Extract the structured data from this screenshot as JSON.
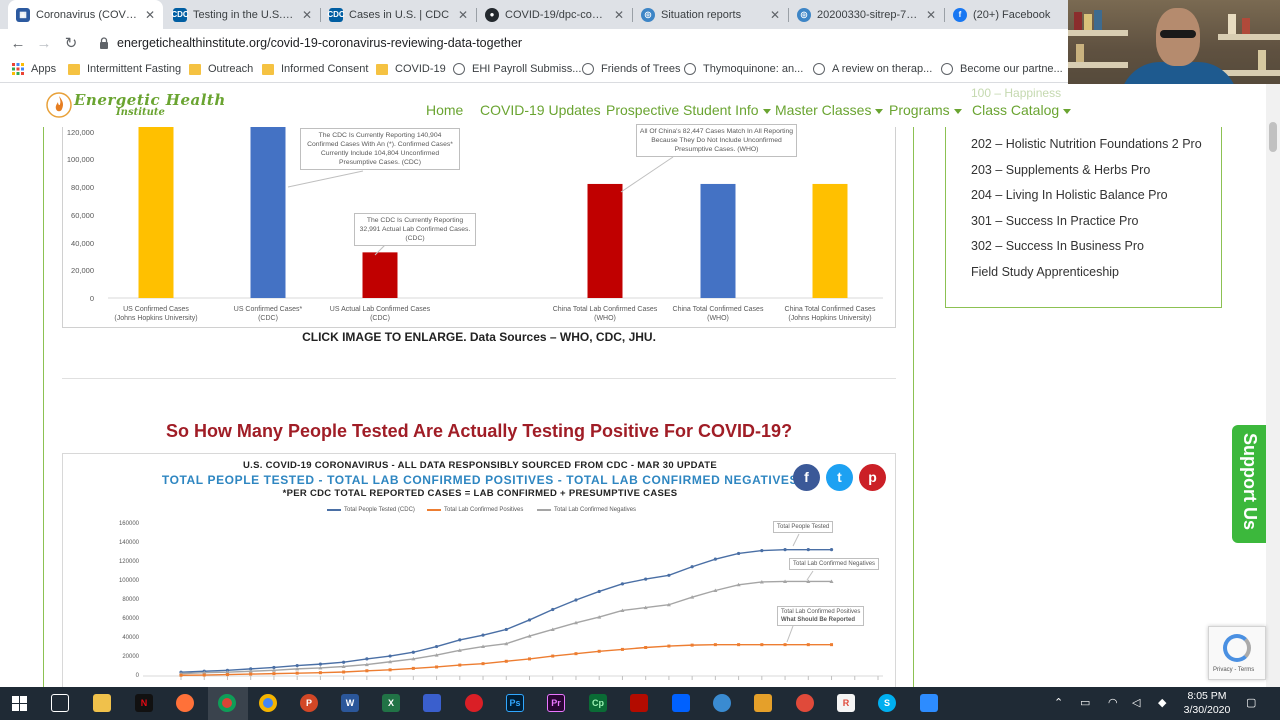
{
  "browser": {
    "tabs": [
      {
        "title": "Coronavirus (COVID-19",
        "icon": "grid-icon",
        "color": "#2c5aa0",
        "active": true
      },
      {
        "title": "Testing in the U.S. | CD",
        "icon": "cdc-icon",
        "color": "#005ea2"
      },
      {
        "title": "Cases in U.S. | CDC",
        "icon": "cdc-icon",
        "color": "#005ea2"
      },
      {
        "title": "COVID-19/dpc-covid19",
        "icon": "github-icon",
        "color": "#24292e"
      },
      {
        "title": "Situation reports",
        "icon": "who-icon",
        "color": "#3d85c6"
      },
      {
        "title": "20200330-sitrep-70-co",
        "icon": "who-icon",
        "color": "#3d85c6"
      },
      {
        "title": "(20+) Facebook",
        "icon": "facebook-icon",
        "color": "#1877f2"
      }
    ],
    "url": "energetichealthinstitute.org/covid-19-coronavirus-reviewing-data-together",
    "bookmarks": [
      {
        "label": "Apps",
        "icon": "apps-icon"
      },
      {
        "label": "Intermittent Fasting",
        "icon": "folder-icon"
      },
      {
        "label": "Outreach",
        "icon": "folder-icon"
      },
      {
        "label": "Informed Consent",
        "icon": "folder-icon"
      },
      {
        "label": "COVID-19",
        "icon": "folder-icon"
      },
      {
        "label": "EHI Payroll Submiss...",
        "icon": "globe-icon"
      },
      {
        "label": "Friends of Trees",
        "icon": "globe-icon"
      },
      {
        "label": "Thymoquinone: an...",
        "icon": "globe-icon"
      },
      {
        "label": "A review on therap...",
        "icon": "globe-icon"
      },
      {
        "label": "Become our partne...",
        "icon": "globe-icon"
      }
    ]
  },
  "site": {
    "logo_line1": "Energetic Health",
    "logo_line2": "Institute",
    "menu": [
      {
        "label": "Home",
        "dropdown": false
      },
      {
        "label": "COVID-19 Updates",
        "dropdown": false
      },
      {
        "label": "Prospective Student Info",
        "dropdown": true
      },
      {
        "label": "Master Classes",
        "dropdown": true
      },
      {
        "label": "Programs",
        "dropdown": true
      },
      {
        "label": "Class Catalog",
        "dropdown": true
      }
    ],
    "accent": "#6aa431"
  },
  "chart1": {
    "ytick_labels": [
      "120,000",
      "100,000",
      "80,000",
      "60,000",
      "40,000",
      "20,000",
      "0"
    ],
    "categories": [
      "US Confirmed Cases\n(Johns Hopkins University)",
      "US Confirmed Cases*\n(CDC)",
      "US Actual Lab Confirmed Cases\n(CDC)",
      "China Total Lab Confirmed Cases\n(WHO)",
      "China Total Confirmed Cases\n(WHO)",
      "China Total Confirmed Cases\n(Johns Hopkins University)"
    ],
    "callout1": "The CDC Is Currently Reporting 140,904 Confirmed Cases With An (*). Confirmed Cases* Currently Include 104,804 Unconfirmed Presumptive Cases. (CDC)",
    "callout2": "The CDC Is Currently Reporting 32,991 Actual Lab Confirmed Cases. (CDC)",
    "callout3": "All Of China's 82,447 Cases Match In All Reporting Because They Do Not Include Unconfirmed Presumptive Cases. (WHO)",
    "caption": "CLICK IMAGE TO ENLARGE. Data Sources – WHO, CDC, JHU."
  },
  "heading": "So How Many People Tested Are Actually Testing Positive For COVID-19?",
  "chart2": {
    "title1": "U.S. COVID-19 CORONAVIRUS - ALL DATA RESPONSIBLY SOURCED FROM CDC - MAR 30 UPDATE",
    "title2": "TOTAL PEOPLE TESTED - TOTAL LAB CONFIRMED POSITIVES - TOTAL LAB CONFIRMED NEGATIVES",
    "title3": "*PER CDC TOTAL REPORTED CASES = LAB CONFIRMED + PRESUMPTIVE CASES",
    "legend": [
      "Total People Tested (CDC)",
      "Total Lab Confirmed Positives",
      "Total Lab Confirmed Negatives"
    ],
    "ann_tested": "Total People Tested",
    "ann_negatives": "Total Lab Confirmed Negatives",
    "ann_positives_1": "Total Lab Confirmed Positives",
    "ann_positives_2": "What Should Be Reported",
    "ytick_labels": [
      "160000",
      "140000",
      "120000",
      "100000",
      "80000",
      "60000",
      "40000",
      "20000",
      "0"
    ]
  },
  "chart_data": [
    {
      "type": "bar",
      "categories": [
        "US Confirmed Cases (Johns Hopkins University)",
        "US Confirmed Cases* (CDC)",
        "US Actual Lab Confirmed Cases (CDC)",
        "China Total Lab Confirmed Cases (WHO)",
        "China Total Confirmed Cases (WHO)",
        "China Total Confirmed Cases (Johns Hopkins University)"
      ],
      "values": [
        143000,
        140904,
        32991,
        82447,
        82447,
        82447
      ],
      "colors": [
        "#ffc000",
        "#4472c4",
        "#c00000",
        "#c00000",
        "#4472c4",
        "#ffc000"
      ],
      "ylim": [
        0,
        120000
      ]
    },
    {
      "type": "line",
      "series": [
        {
          "name": "Total People Tested (CDC)",
          "color": "#4a6fa5",
          "values": [
            4000,
            5000,
            6000,
            7500,
            9000,
            11000,
            12500,
            14500,
            18000,
            21000,
            25000,
            31000,
            38000,
            43000,
            49000,
            59000,
            70000,
            80000,
            89000,
            97000,
            102000,
            106000,
            115000,
            123000,
            129000,
            132000,
            133000,
            133000,
            133000
          ]
        },
        {
          "name": "Total Lab Confirmed Negatives",
          "color": "#a5a5a5",
          "values": [
            2500,
            3500,
            4000,
            5000,
            6000,
            7500,
            8500,
            10000,
            12000,
            15000,
            18000,
            22000,
            27000,
            31000,
            34000,
            42000,
            49000,
            56000,
            62000,
            69000,
            72000,
            75000,
            83000,
            90000,
            96000,
            99000,
            99500,
            99500,
            99500
          ]
        },
        {
          "name": "Total Lab Confirmed Positives",
          "color": "#ed7d31",
          "values": [
            800,
            1000,
            1500,
            2000,
            2500,
            3000,
            3500,
            4200,
            5500,
            6500,
            8000,
            9500,
            11500,
            13000,
            15500,
            18000,
            21000,
            23500,
            26000,
            28000,
            30000,
            31500,
            32500,
            33000,
            33000,
            33000,
            33000,
            33000,
            33000
          ]
        }
      ],
      "ylim": [
        0,
        160000
      ]
    }
  ],
  "sidebar": {
    "faded_item": "100 – Happiness",
    "items": [
      "202 – Holistic Nutrition Foundations 2 Pro",
      "203 – Supplements & Herbs Pro",
      "204 – Living In Holistic Balance Pro",
      "301 – Success In Practice Pro",
      "302 – Success In Business Pro",
      "Field Study Apprenticeship"
    ]
  },
  "support_label": "Support Us",
  "recaptcha_text": "Privacy - Terms",
  "taskbar": {
    "time": "8:05 PM",
    "date": "3/30/2020"
  }
}
